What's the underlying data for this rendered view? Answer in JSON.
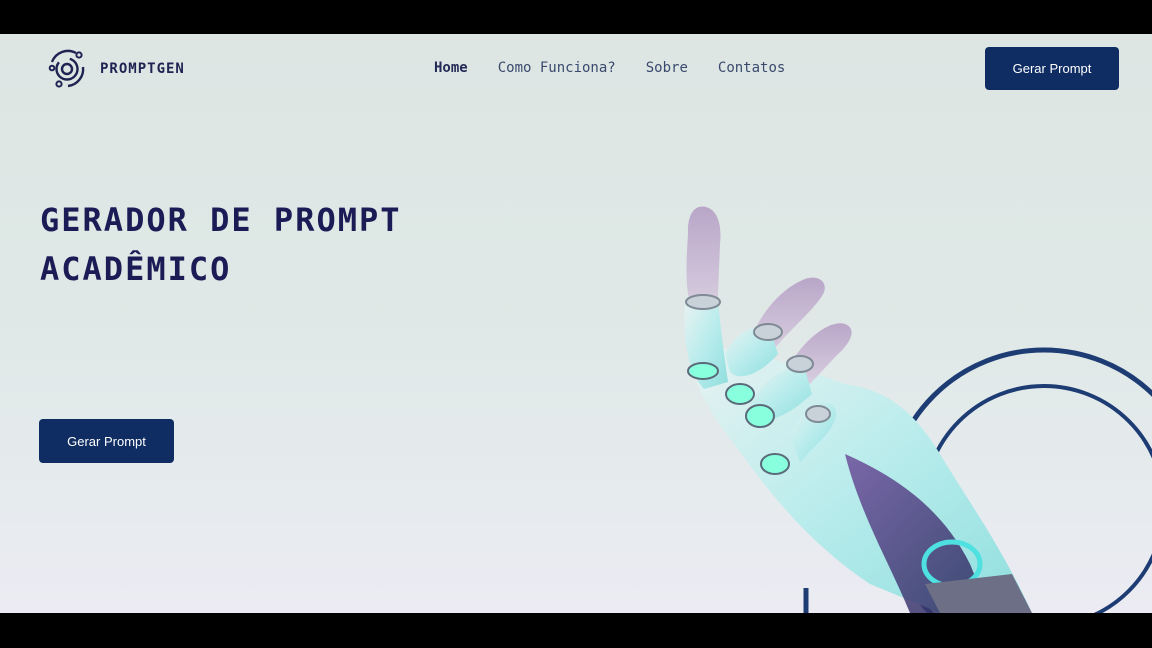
{
  "header": {
    "brand": "PROMPTGEN",
    "logo_icon": "orbit-logo-icon",
    "nav": [
      {
        "label": "Home",
        "active": true
      },
      {
        "label": "Como Funciona?",
        "active": false
      },
      {
        "label": "Sobre",
        "active": false
      },
      {
        "label": "Contatos",
        "active": false
      }
    ],
    "cta_label": "Gerar Prompt"
  },
  "hero": {
    "title": "GERADOR DE PROMPT ACADÊMICO",
    "cta_label": "Gerar Prompt",
    "image": "robotic-hand-illustration"
  },
  "colors": {
    "brand_navy": "#0f2c63",
    "title": "#1b1c55",
    "nav_text": "#3a4a6e",
    "background": "#dfe8e6"
  }
}
